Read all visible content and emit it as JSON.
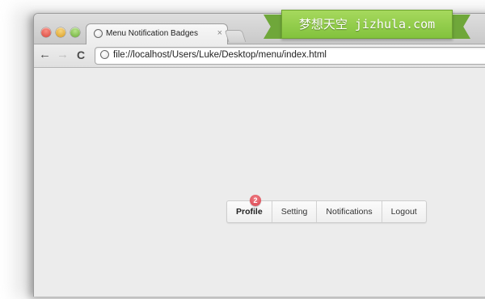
{
  "browser": {
    "tab_title": "Menu Notification Badges",
    "tab_close": "×",
    "url": "file://localhost/Users/Luke/Desktop/menu/index.html",
    "back_icon": "arrow-left-icon",
    "forward_icon": "arrow-right-icon",
    "reload_icon": "reload-icon",
    "back_glyph": "←",
    "forward_glyph": "→",
    "reload_glyph": "C"
  },
  "menu": {
    "items": [
      {
        "label": "Profile",
        "active": true,
        "badge": "2"
      },
      {
        "label": "Setting"
      },
      {
        "label": "Notifications"
      },
      {
        "label": "Logout"
      }
    ],
    "badge_color": "#e0525b"
  },
  "watermark": {
    "text": "梦想天空 jizhula.com",
    "color": "#8cc94a"
  }
}
